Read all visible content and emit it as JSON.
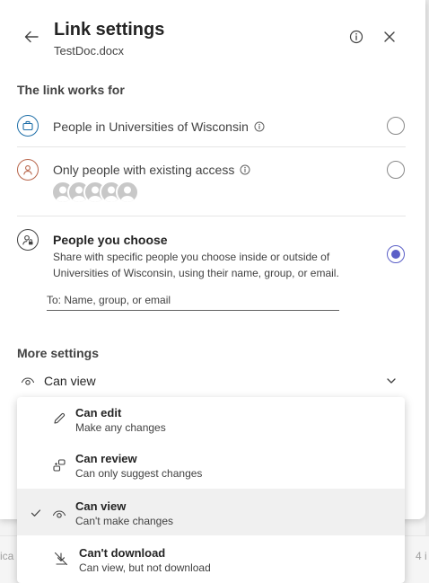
{
  "header": {
    "title": "Link settings",
    "file_name": "TestDoc.docx"
  },
  "link_works_for": {
    "heading": "The link works for",
    "options": [
      {
        "label": "People in Universities of Wisconsin",
        "has_info": true,
        "selected": false,
        "icon": "briefcase-icon"
      },
      {
        "label": "Only people with existing access",
        "has_info": true,
        "selected": false,
        "icon": "person-icon",
        "avatar_count": 5
      },
      {
        "label": "People you choose",
        "description": "Share with specific people you choose inside or outside of Universities of Wisconsin, using their name, group, or email.",
        "selected": true,
        "icon": "person-lock-icon"
      }
    ],
    "to_placeholder": "To: Name, group, or email"
  },
  "more_settings": {
    "heading": "More settings",
    "permission_selected": "Can view"
  },
  "permission_menu": {
    "items": [
      {
        "title": "Can edit",
        "subtitle": "Make any changes",
        "icon": "pencil-icon",
        "selected": false
      },
      {
        "title": "Can review",
        "subtitle": "Can only suggest changes",
        "icon": "review-icon",
        "selected": false
      },
      {
        "title": "Can view",
        "subtitle": "Can't make changes",
        "icon": "eye-icon",
        "selected": true
      },
      {
        "title": "Can't download",
        "subtitle": "Can view, but not download",
        "icon": "no-download-icon",
        "selected": false
      }
    ]
  },
  "background": {
    "left_text": "ica",
    "right_text": "4 i"
  },
  "colors": {
    "accent": "#5b5fc7",
    "text_primary": "#242424",
    "text_secondary": "#424242",
    "org_icon": "#1f6fa8",
    "existing_icon": "#b8654a"
  }
}
